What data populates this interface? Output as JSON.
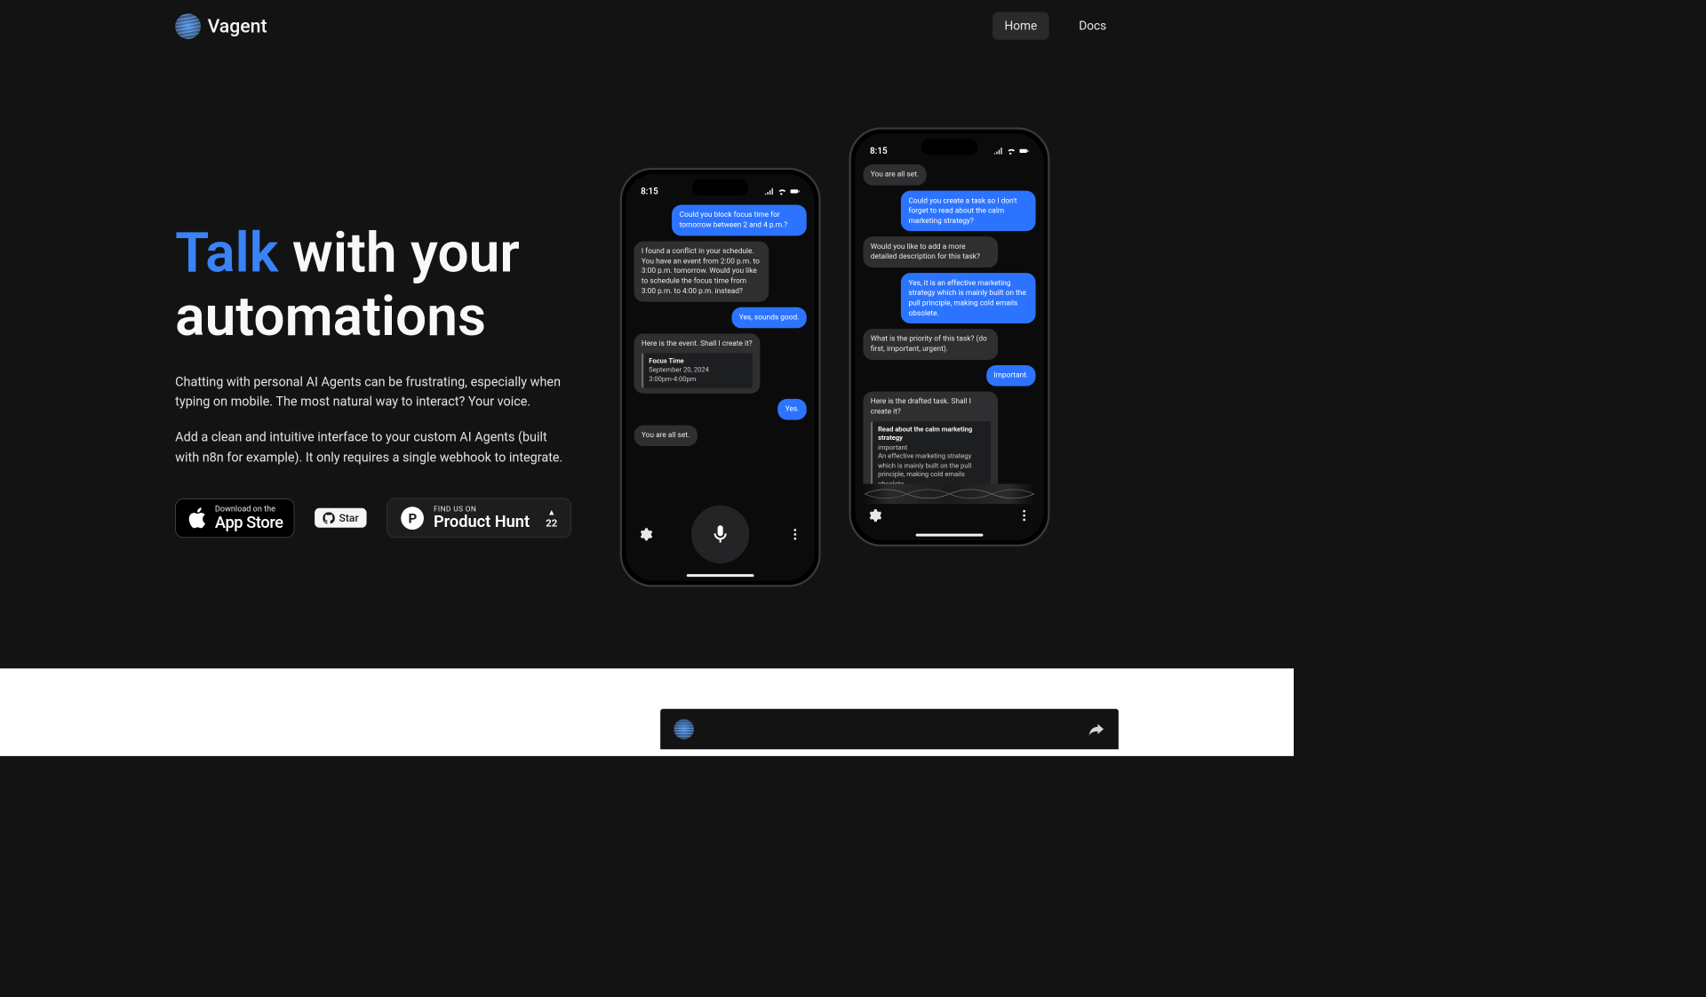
{
  "brand": "Vagent",
  "nav": {
    "home": "Home",
    "docs": "Docs"
  },
  "hero": {
    "talk": "Talk",
    "rest1": " with your",
    "line2": "automations",
    "para1": "Chatting with personal AI Agents can be frustrating, especially when typing on mobile. The most natural way to interact? Your voice.",
    "para2": "Add a clean and intuitive interface to your custom AI Agents (built with n8n for example). It only requires a single webhook to integrate."
  },
  "cta": {
    "appstore_small": "Download on the",
    "appstore_big": "App Store",
    "github": "Star",
    "ph_small": "FIND US ON",
    "ph_big": "Product Hunt",
    "ph_votes": "22"
  },
  "phoneA": {
    "time": "8:15",
    "m1": "Could you block focus time for tomorrow between 2 and 4 p.m.?",
    "m2": "I found a conflict in your schedule. You have an event from 2:00 p.m. to 3:00 p.m. tomorrow. Would you like to schedule the focus time from 3:00 p.m. to 4:00 p.m. instead?",
    "m3": "Yes, sounds good.",
    "m4": "Here is the event. Shall I create it?",
    "ev_title": "Focus Time",
    "ev_date": "September 20, 2024",
    "ev_time": "3:00pm-4:00pm",
    "m5": "Yes.",
    "m6": "You are all set."
  },
  "phoneB": {
    "time": "8:15",
    "m0": "You are all set.",
    "m1": "Could you create a task so I don't forget to read about the calm marketing strategy?",
    "m2": "Would you like to add a more detailed description for this task?",
    "m3": "Yes, it is an effective marketing strategy which is mainly built on the pull principle, making cold emails obsolete.",
    "m4": "What is the priority of this task? (do first, important, urgent).",
    "m5": "Important.",
    "m6": "Here is the drafted task. Shall I create it?",
    "ev_title": "Read about the calm marketing strategy",
    "ev_pri": "important",
    "ev_desc": "An effective marketing strategy which is mainly built on the pull principle, making cold emails obsolete."
  },
  "video_title": ""
}
